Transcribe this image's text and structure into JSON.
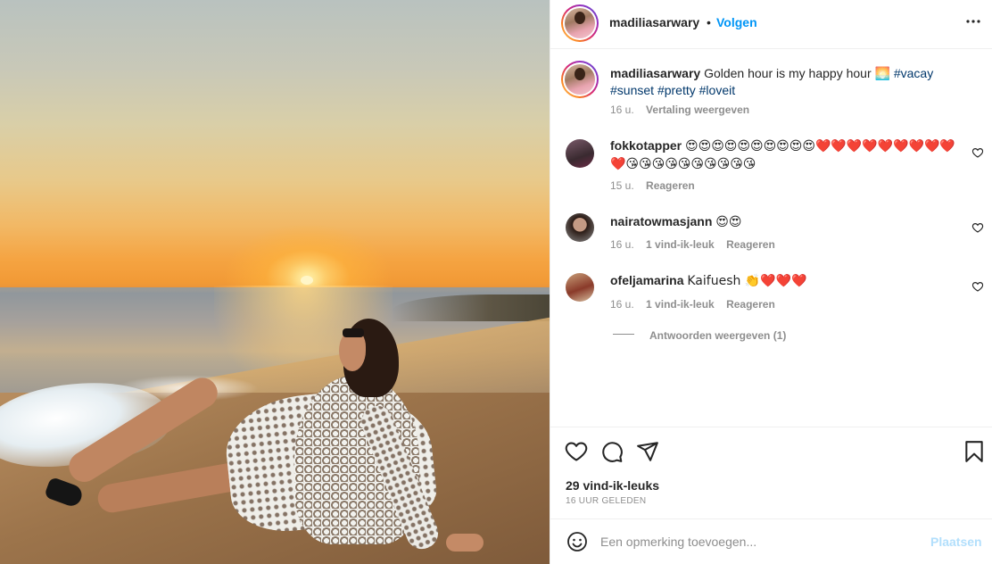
{
  "post": {
    "username": "madiliasarwary",
    "separator": "•",
    "follow_label": "Volgen",
    "more_icon": "more-horizontal-icon"
  },
  "caption": {
    "username": "madiliasarwary",
    "text": "Golden hour is my happy hour ",
    "emoji": "🌅",
    "tags": [
      "#vacay",
      "#sunset",
      "#pretty",
      "#loveit"
    ],
    "time": "16 u.",
    "translate_label": "Vertaling weergeven"
  },
  "comments": [
    {
      "username": "fokkotapper",
      "text": "😍😍😍😍😍😍😍😍😍😍❤️❤️❤️❤️❤️❤️❤️❤️❤️❤️😘😘😘😘😘😘😘😘😘😘",
      "time": "15 u.",
      "likes": "",
      "reply_label": "Reageren"
    },
    {
      "username": "nairatowmasjann",
      "text": "😍😍",
      "time": "16 u.",
      "likes": "1 vind-ik-leuk",
      "reply_label": "Reageren"
    },
    {
      "username": "ofeljamarina",
      "text": "Kaifuesh 👏❤️❤️❤️",
      "time": "16 u.",
      "likes": "1 vind-ik-leuk",
      "reply_label": "Reageren"
    }
  ],
  "view_replies": "Antwoorden weergeven (1)",
  "actions": {
    "like_icon": "heart-icon",
    "comment_icon": "comment-icon",
    "share_icon": "send-icon",
    "save_icon": "bookmark-icon",
    "likes": "29 vind-ik-leuks",
    "posted": "16 UUR GELEDEN"
  },
  "add_comment": {
    "emoji_icon": "smiley-icon",
    "placeholder": "Een opmerking toevoegen...",
    "post_label": "Plaatsen"
  },
  "colors": {
    "link_blue": "#0095f6",
    "hashtag": "#00376b",
    "muted": "#8e8e8e",
    "post_disabled": "#b2dffc"
  }
}
